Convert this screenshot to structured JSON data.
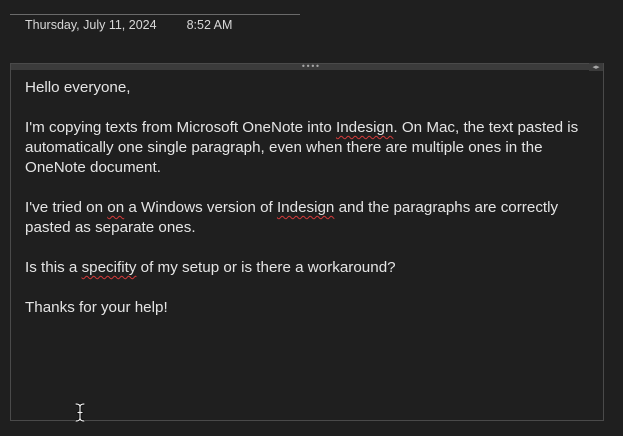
{
  "header": {
    "date": "Thursday, July 11, 2024",
    "time": "8:52 AM"
  },
  "container": {
    "grip_icon": "drag-grip-icon",
    "grip_glyph": "••••",
    "resize_icon": "expand-arrows-icon",
    "resize_glyph": "◂▸"
  },
  "note": {
    "greeting": "Hello everyone,",
    "p1_a": "I'm copying texts from Microsoft OneNote into ",
    "p1_spell": "Indesign",
    "p1_b": ". On Mac, the text pasted is automatically one single paragraph, even when there are multiple ones in the OneNote document.",
    "p2_a": "I've tried on ",
    "p2_spell1": "on",
    "p2_b": " a Windows version of ",
    "p2_spell2": "Indesign",
    "p2_c": " and the paragraphs are correctly pasted as separate ones.",
    "p3_a": "Is this a ",
    "p3_spell": "specifity",
    "p3_b": " of my setup or is there a workaround?",
    "closing": "Thanks for your help!"
  },
  "cursor": {
    "icon": "text-cursor-icon"
  },
  "colors": {
    "background": "#1f1f1f",
    "text": "#e4e4e4",
    "spellcheck": "#d23a3a",
    "border": "#4a4a4a"
  }
}
